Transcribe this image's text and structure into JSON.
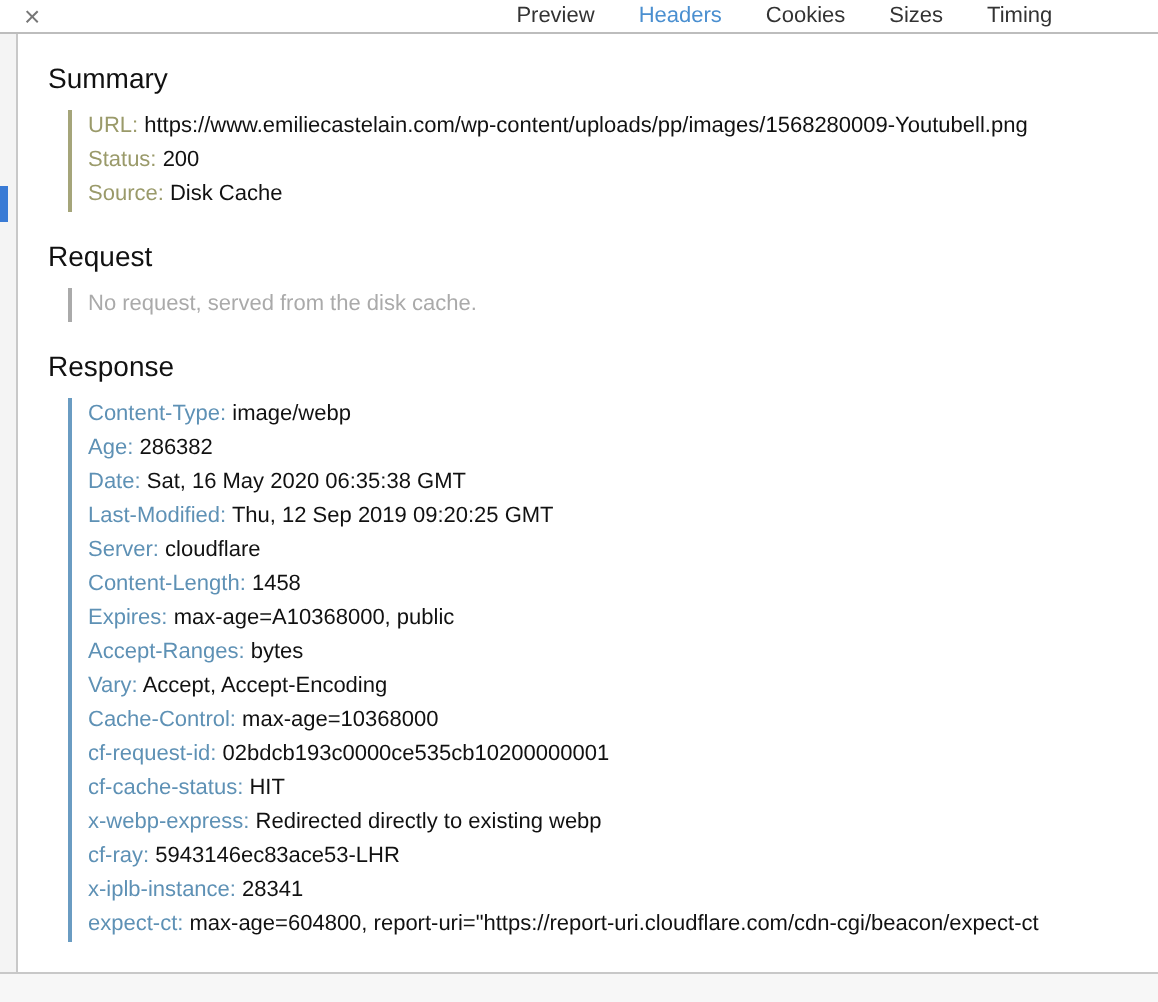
{
  "close_button": {
    "label": "×"
  },
  "tabs": [
    {
      "label": "Preview",
      "selected": false
    },
    {
      "label": "Headers",
      "selected": true
    },
    {
      "label": "Cookies",
      "selected": false
    },
    {
      "label": "Sizes",
      "selected": false
    },
    {
      "label": "Timing",
      "selected": false
    }
  ],
  "sections": [
    {
      "title": "Summary",
      "kind": "summary",
      "rows": [
        {
          "key": "URL:",
          "value": "https://www.emiliecastelain.com/wp-content/uploads/pp/images/1568280009-Youtubell.png"
        },
        {
          "key": "Status:",
          "value": "200"
        },
        {
          "key": "Source:",
          "value": "Disk Cache"
        }
      ]
    },
    {
      "title": "Request",
      "kind": "empty",
      "note": "No request, served from the disk cache."
    },
    {
      "title": "Response",
      "kind": "response",
      "rows": [
        {
          "key": "Content-Type:",
          "value": "image/webp"
        },
        {
          "key": "Age:",
          "value": "286382"
        },
        {
          "key": "Date:",
          "value": "Sat, 16 May 2020 06:35:38 GMT"
        },
        {
          "key": "Last-Modified:",
          "value": "Thu, 12 Sep 2019 09:20:25 GMT"
        },
        {
          "key": "Server:",
          "value": "cloudflare"
        },
        {
          "key": "Content-Length:",
          "value": "1458"
        },
        {
          "key": "Expires:",
          "value": "max-age=A10368000, public"
        },
        {
          "key": "Accept-Ranges:",
          "value": "bytes"
        },
        {
          "key": "Vary:",
          "value": "Accept, Accept-Encoding"
        },
        {
          "key": "Cache-Control:",
          "value": "max-age=10368000"
        },
        {
          "key": "cf-request-id:",
          "value": "02bdcb193c0000ce535cb10200000001"
        },
        {
          "key": "cf-cache-status:",
          "value": "HIT"
        },
        {
          "key": "x-webp-express:",
          "value": "Redirected directly to existing webp"
        },
        {
          "key": "cf-ray:",
          "value": "5943146ec83ace53-LHR"
        },
        {
          "key": "x-iplb-instance:",
          "value": "28341"
        },
        {
          "key": "expect-ct:",
          "value": "max-age=604800, report-uri=\"https://report-uri.cloudflare.com/cdn-cgi/beacon/expect-ct"
        }
      ]
    }
  ]
}
